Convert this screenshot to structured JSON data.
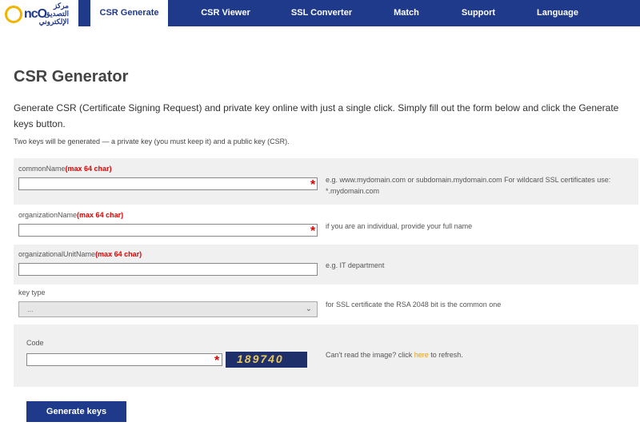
{
  "logo": {
    "text": "ncO",
    "arabic_1": "مركز",
    "arabic_2": "التصديق",
    "arabic_3": "الإلكتروني"
  },
  "nav": {
    "tabs": [
      "CSR Generate",
      "CSR Viewer",
      "SSL Converter",
      "Match",
      "Support",
      "Language"
    ],
    "active": 0
  },
  "page": {
    "title": "CSR Generator",
    "intro": "Generate CSR (Certificate Signing Request) and private key online with just a single click. Simply fill out the form below and click the Generate keys button.",
    "note": "Two keys will be generated — a private key (you must keep it) and a public key (CSR)."
  },
  "form": {
    "common_name": {
      "label": "commonName",
      "req": "(max 64 char)",
      "value": "",
      "hint": "e.g. www.mydomain.com or subdomain.mydomain.com For wildcard SSL certificates use: *.mydomain.com"
    },
    "org_name": {
      "label": "organizationName",
      "req": "(max 64 char)",
      "value": "",
      "hint": "if you are an individual, provide your full name"
    },
    "org_unit": {
      "label": "organizationalUnitName",
      "req": "(max 64 char)",
      "value": "",
      "hint": "e.g. IT department"
    },
    "key_type": {
      "label": "key type",
      "selected": "...",
      "hint": "for SSL certificate the RSA 2048 bit is the common one"
    },
    "code": {
      "label": "Code",
      "value": "",
      "captcha_text": "189740",
      "hint_before": "Can't read the image? click ",
      "hint_link": "here",
      "hint_after": " to refresh."
    },
    "required_mark": "*",
    "submit": "Generate keys"
  }
}
